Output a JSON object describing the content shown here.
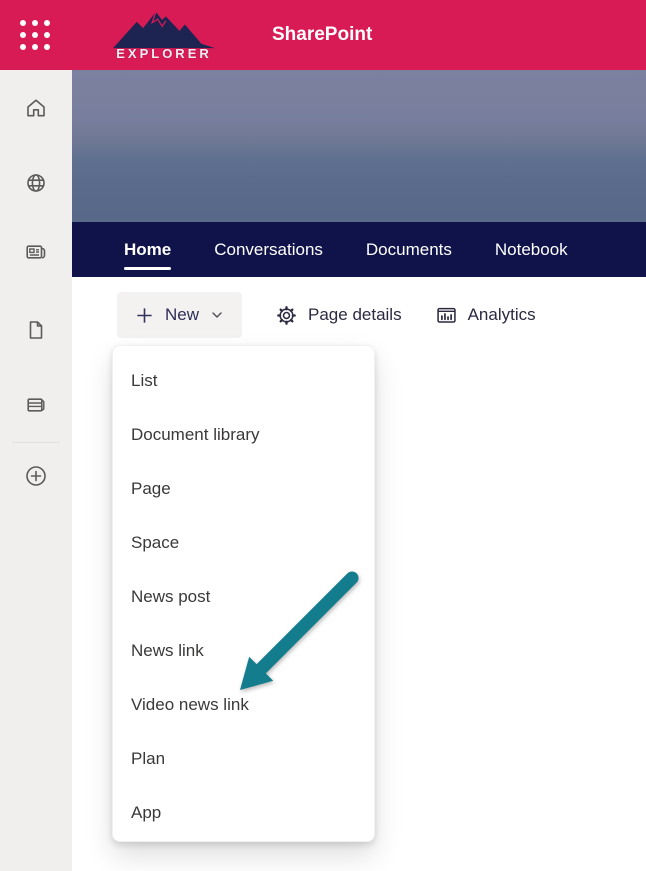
{
  "topbar": {
    "app_title": "SharePoint",
    "logo_text": "EXPLORER"
  },
  "sidebar": {
    "items": [
      {
        "icon": "home"
      },
      {
        "icon": "global-sites"
      },
      {
        "icon": "news"
      },
      {
        "icon": "documents"
      },
      {
        "icon": "content-library"
      },
      {
        "icon": "create-site"
      }
    ]
  },
  "nav": {
    "tabs": [
      {
        "label": "Home",
        "active": true
      },
      {
        "label": "Conversations",
        "active": false
      },
      {
        "label": "Documents",
        "active": false
      },
      {
        "label": "Notebook",
        "active": false
      }
    ]
  },
  "toolbar": {
    "new_button": {
      "label": "New"
    },
    "page_details": {
      "label": "Page details"
    },
    "analytics": {
      "label": "Analytics"
    }
  },
  "new_menu": {
    "items": [
      "List",
      "Document library",
      "Page",
      "Space",
      "News post",
      "News link",
      "Video news link",
      "Plan",
      "App"
    ]
  },
  "annotation": {
    "type": "arrow",
    "points_to": "Video news link",
    "color": "#137d8d"
  },
  "colors": {
    "brand_pink": "#d81a55",
    "nav_navy": "#10134a",
    "accent_teal": "#137d8d"
  }
}
